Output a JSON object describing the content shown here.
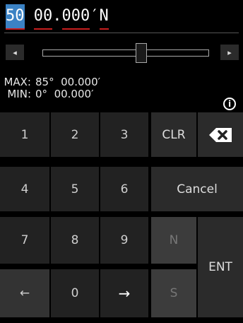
{
  "entry": {
    "selected_digits": "50",
    "minutes": "00",
    "dot": ".",
    "decimals": "000",
    "unit": "′",
    "hemisphere": "N"
  },
  "slider": {
    "left_glyph": "◂",
    "right_glyph": "▸",
    "position_fraction": 0.59
  },
  "range": {
    "max_label": "MAX:",
    "max_value": "85°  00.000′",
    "min_label": "MIN:",
    "min_value": "0°  00.000′",
    "info_glyph": "i"
  },
  "keys": {
    "k1": "1",
    "k2": "2",
    "k3": "3",
    "k4": "4",
    "k5": "5",
    "k6": "6",
    "k7": "7",
    "k8": "8",
    "k9": "9",
    "k0": "0",
    "left_arrow": "←",
    "right_arrow": "→",
    "clr": "CLR",
    "cancel": "Cancel",
    "n": "N",
    "s": "S",
    "ent": "ENT"
  },
  "icons": {
    "backspace": "backspace-icon",
    "info": "info-icon"
  },
  "colors": {
    "selection": "#3b82c4",
    "underline": "#c81e1e"
  }
}
